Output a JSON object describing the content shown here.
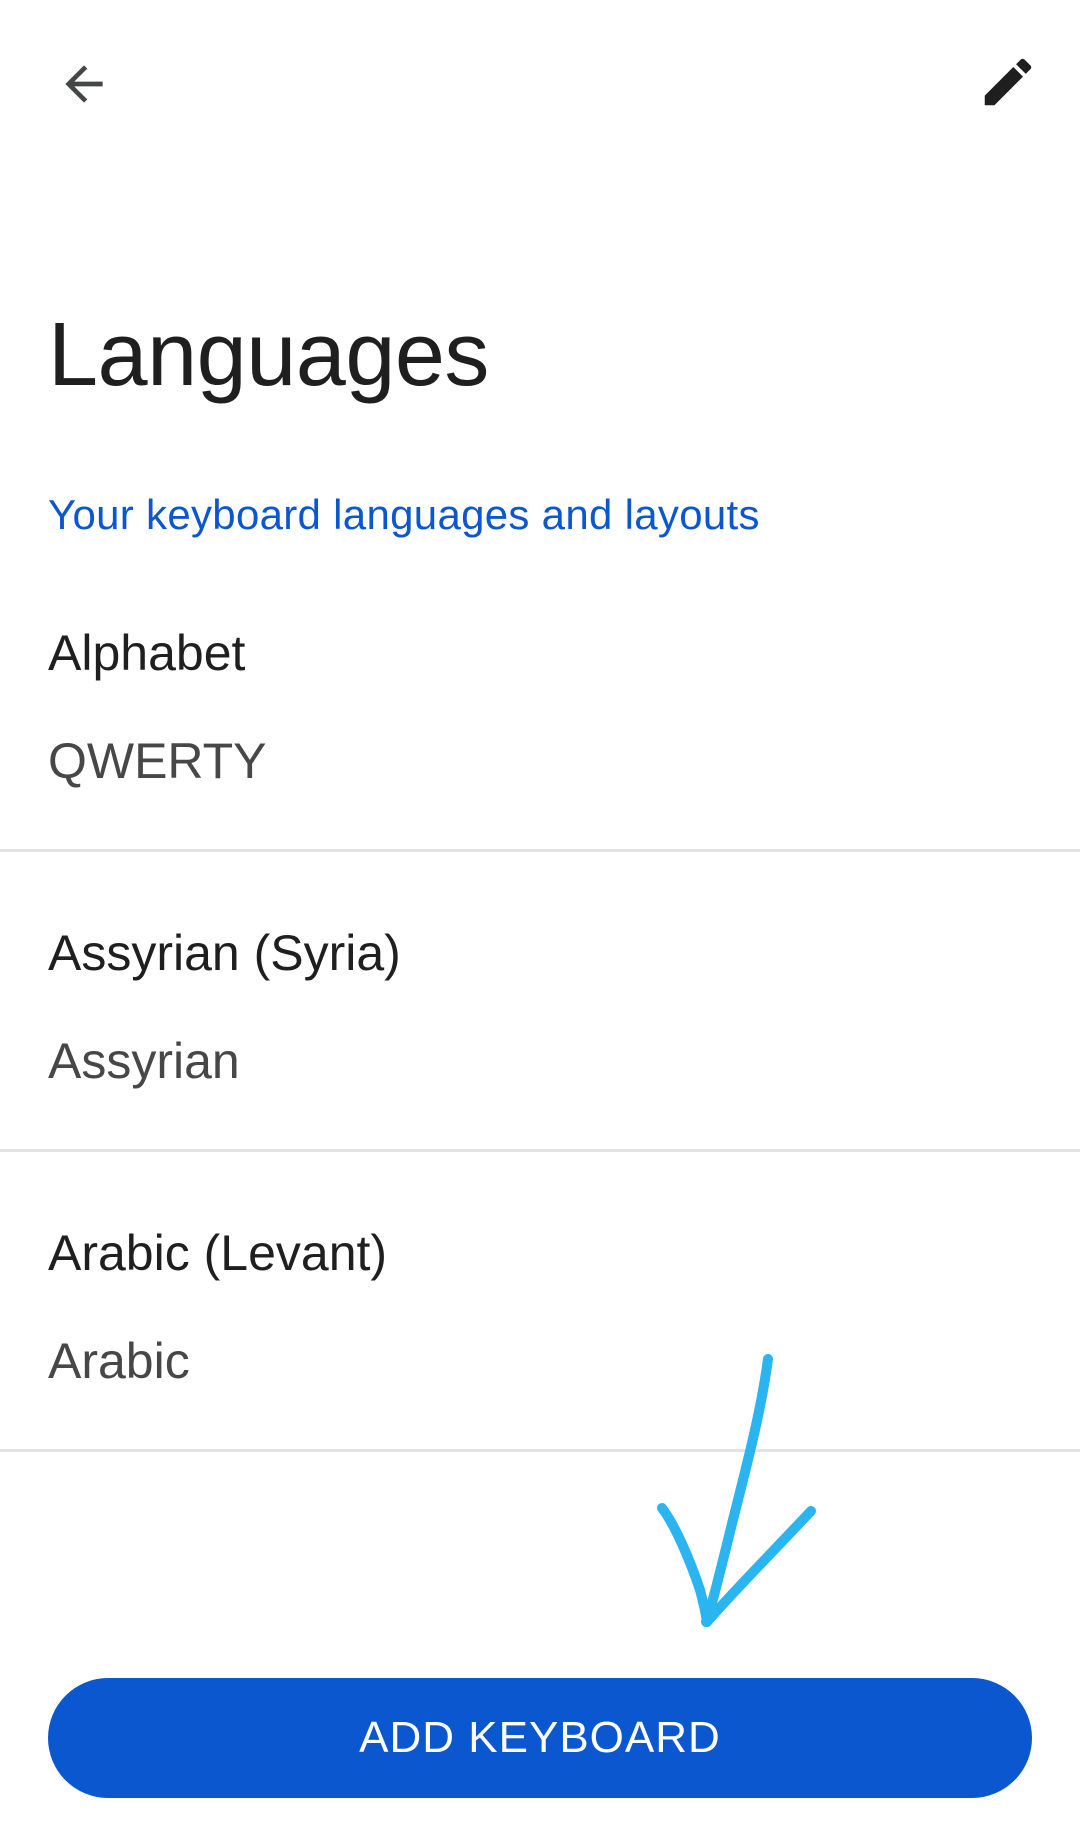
{
  "colors": {
    "accent": "#0b57d0",
    "title_text": "#1f1f1f",
    "secondary_text": "#474747",
    "divider": "#e3e3e3",
    "annotation": "#2bb5f0"
  },
  "top_bar": {
    "back_icon": "arrow-back-icon",
    "edit_icon": "pencil-edit-icon"
  },
  "page": {
    "title": "Languages",
    "section_header": "Your keyboard languages and layouts"
  },
  "languages": [
    {
      "name": "Alphabet",
      "layout": "QWERTY"
    },
    {
      "name": "Assyrian (Syria)",
      "layout": "Assyrian"
    },
    {
      "name": "Arabic (Levant)",
      "layout": "Arabic"
    }
  ],
  "actions": {
    "add_keyboard_label": "ADD KEYBOARD"
  }
}
